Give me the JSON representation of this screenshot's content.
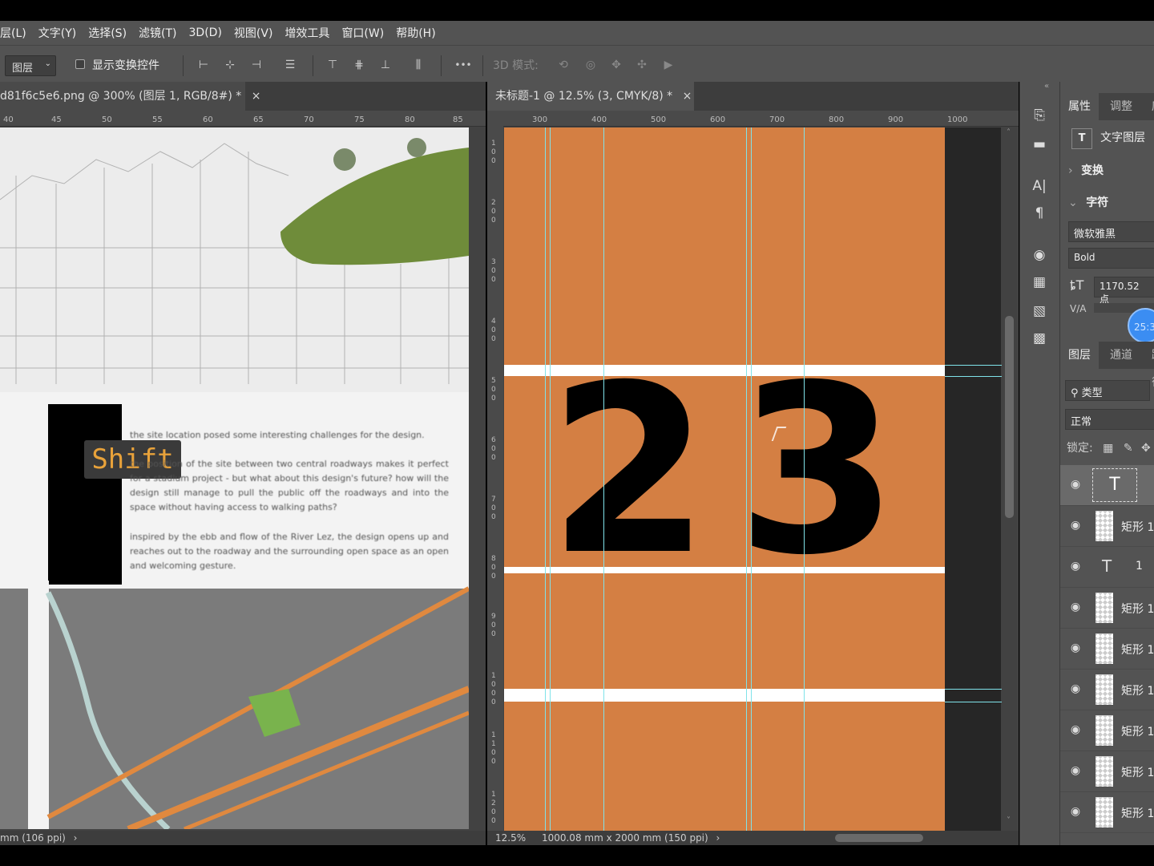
{
  "menubar": [
    "层(L)",
    "文字(Y)",
    "选择(S)",
    "滤镜(T)",
    "3D(D)",
    "视图(V)",
    "增效工具",
    "窗口(W)",
    "帮助(H)"
  ],
  "options_bar": {
    "auto_select_target": "图层",
    "show_transform_controls_label": "显示变换控件",
    "show_transform_controls_checked": false,
    "mode_3d_label": "3D 模式:",
    "more_label": "•••"
  },
  "doc_left": {
    "tab_title": "d81f6c5e6.png @ 300% (图层 1, RGB/8#) *",
    "ruler_ticks": [
      "40",
      "45",
      "50",
      "55",
      "60",
      "65",
      "70",
      "75",
      "80",
      "85"
    ],
    "status": "mm (106 ppi)",
    "shift_badge": "Shift",
    "paragraph1": "the site location posed some interesting challenges for the design.",
    "paragraph2": "the position of the site between two central roadways makes it perfect for a stadium project - but what about this design's future? how will the design still manage to pull the public off the roadways and into the space without having access to walking paths?",
    "paragraph3": "inspired by the ebb and flow of the River Lez, the design opens up and reaches out to the roadway and the surrounding open space as an open and welcoming gesture."
  },
  "doc_right": {
    "tab_title": "未标题-1 @ 12.5% (3, CMYK/8) *",
    "ruler_ticks": [
      "300",
      "400",
      "500",
      "600",
      "700",
      "800",
      "900",
      "1000"
    ],
    "vruler_ticks": [
      "100",
      "200",
      "300",
      "400",
      "500",
      "600",
      "700",
      "800",
      "900",
      "1000",
      "1100",
      "1200"
    ],
    "zoom": "12.5%",
    "doc_size": "1000.08 mm x 2000 mm (150 ppi)",
    "glyph_left": "2",
    "glyph_right": "3",
    "canvas_color": "#d47f43"
  },
  "properties": {
    "tabs": [
      "属性",
      "调整",
      "库"
    ],
    "layer_kind": "文字图层",
    "transform_label": "变换",
    "character_label": "字符",
    "font_family": "微软雅黑",
    "font_style": "Bold",
    "font_size": "1170.52 点",
    "tracking_label": "V/A",
    "timer": "25:3"
  },
  "layers_panel": {
    "tabs": [
      "图层",
      "通道",
      "路径"
    ],
    "filter_kind": "类型",
    "blend_mode": "正常",
    "lock_label": "锁定:",
    "layers": [
      {
        "name": "",
        "type": "text-selected"
      },
      {
        "name": "矩形 1",
        "type": "shape"
      },
      {
        "name": "1",
        "type": "text"
      },
      {
        "name": "矩形 1",
        "type": "shape"
      },
      {
        "name": "矩形 1",
        "type": "shape"
      },
      {
        "name": "矩形 1",
        "type": "shape"
      },
      {
        "name": "矩形 1",
        "type": "shape"
      },
      {
        "name": "矩形 1",
        "type": "shape"
      },
      {
        "name": "矩形 1",
        "type": "shape"
      }
    ]
  }
}
